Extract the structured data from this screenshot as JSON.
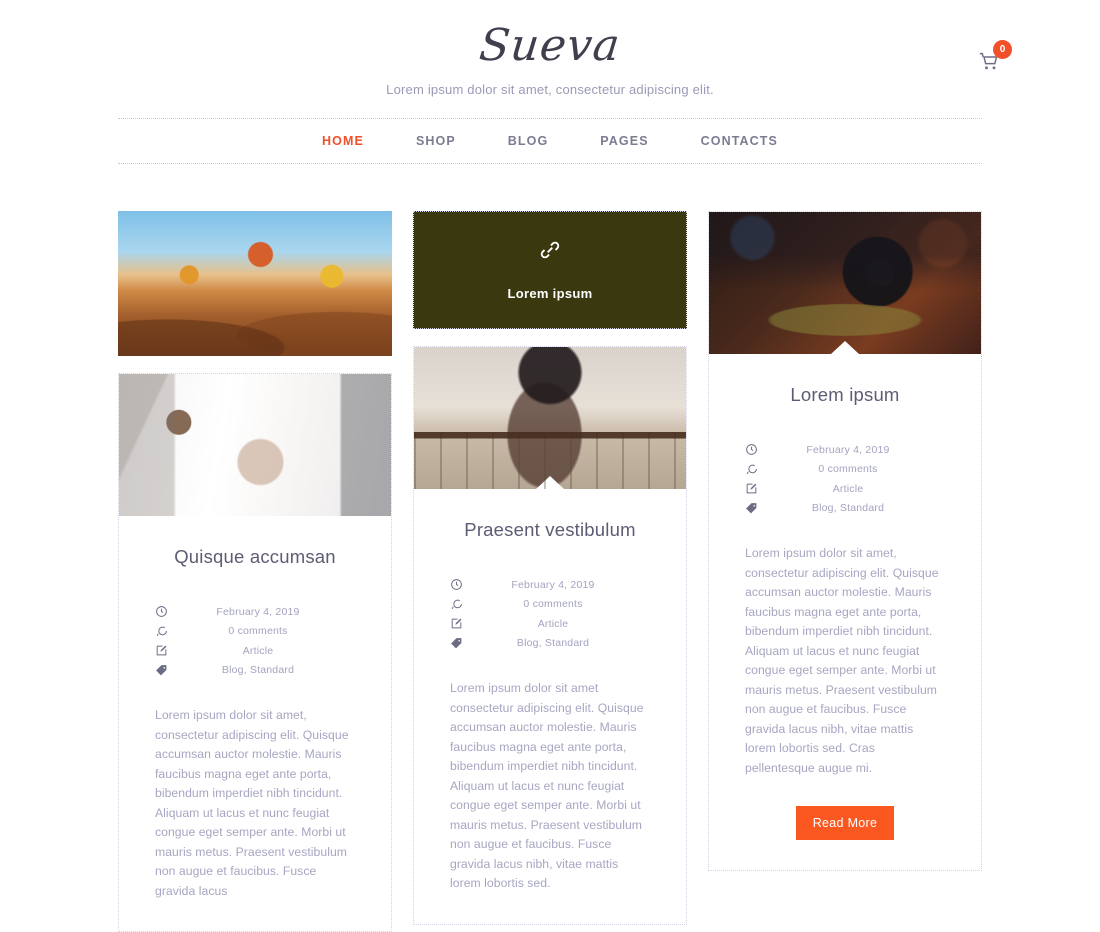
{
  "header": {
    "site_title": "Sueva",
    "tagline": "Lorem ipsum dolor sit amet, consectetur adipiscing elit.",
    "cart": {
      "icon": "shopping-cart-icon",
      "count": "0",
      "badge_color": "#f0502a"
    }
  },
  "nav": {
    "items": [
      {
        "label": "HOME",
        "active": true
      },
      {
        "label": "SHOP",
        "active": false
      },
      {
        "label": "BLOG",
        "active": false
      },
      {
        "label": "PAGES",
        "active": false
      },
      {
        "label": "CONTACTS",
        "active": false
      }
    ],
    "active_color": "#f0502a",
    "inactive_color": "#7b7b92"
  },
  "meta_labels": {
    "date_icon": "clock-icon",
    "comments_icon": "comment-bubble-icon",
    "category_icon": "pencil-square-icon",
    "tags_icon": "tag-icon"
  },
  "posts": {
    "left": {
      "images": [
        "hot-air-balloons-desert-photo",
        "desk-flatlay-phone-photo"
      ],
      "title": "Quisque accumsan",
      "date": "February 4, 2019",
      "comments": "0 comments",
      "category": "Article",
      "tags": "Blog, Standard",
      "excerpt": "Lorem ipsum dolor sit amet, consectetur adipiscing elit. Quisque accumsan auctor molestie. Mauris faucibus magna eget ante porta, bibendum imperdiet nibh tincidunt. Aliquam ut lacus et nunc feugiat congue eget semper ante. Morbi ut mauris metus. Praesent vestibulum non augue et faucibus. Fusce gravida lacus"
    },
    "middle": {
      "link_card": {
        "icon": "chain-link-icon",
        "label": "Lorem ipsum",
        "background": "#39380f"
      },
      "image": "fashion-woman-hat-balcony-photo",
      "title": "Praesent vestibulum",
      "date": "February 4, 2019",
      "comments": "0 comments",
      "category": "Article",
      "tags": "Blog, Standard",
      "excerpt": "Lorem ipsum dolor sit amet consectetur adipiscing elit. Quisque accumsan auctor molestie. Mauris faucibus magna eget ante porta, bibendum imperdiet nibh tincidunt. Aliquam ut lacus et nunc feugiat congue eget semper ante. Morbi ut mauris metus. Praesent vestibulum non augue et faucibus. Fusce gravida lacus nibh, vitae mattis lorem lobortis sed."
    },
    "right": {
      "image": "vintage-camera-photo",
      "title": "Lorem ipsum",
      "date": "February 4, 2019",
      "comments": "0 comments",
      "category": "Article",
      "tags": "Blog, Standard",
      "excerpt": "Lorem ipsum dolor sit amet, consectetur adipiscing elit. Quisque accumsan auctor molestie. Mauris faucibus magna eget ante porta, bibendum imperdiet nibh tincidunt. Aliquam ut lacus et nunc feugiat congue eget semper ante. Morbi ut mauris metus. Praesent vestibulum non augue et faucibus. Fusce gravida lacus nibh, vitae mattis lorem lobortis sed. Cras pellentesque augue mi.",
      "read_more": "Read More",
      "read_more_color": "#fb5720"
    }
  }
}
